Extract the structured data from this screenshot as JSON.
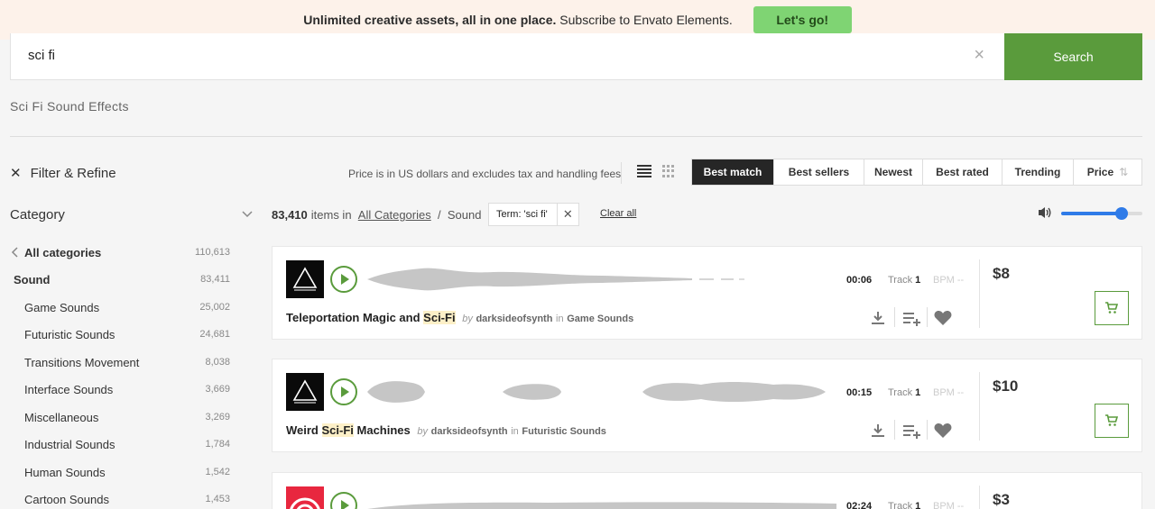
{
  "banner": {
    "text_bold": "Unlimited creative assets, all in one place.",
    "text_rest": "Subscribe to Envato Elements.",
    "button": "Let's go!"
  },
  "search": {
    "value": "sci fi",
    "clear": "×",
    "button": "Search"
  },
  "page_subtitle": "Sci Fi Sound Effects",
  "filter_label": "Filter & Refine",
  "price_note": "Price is in US dollars and excludes tax and handling fees",
  "sort_options": [
    "Best match",
    "Best sellers",
    "Newest",
    "Best rated",
    "Trending",
    "Price"
  ],
  "sort_active": "Best match",
  "category": {
    "title": "Category",
    "items": [
      {
        "label": "All categories",
        "count": "110,613"
      },
      {
        "label": "Sound",
        "count": "83,411"
      },
      {
        "label": "Game Sounds",
        "count": "25,002"
      },
      {
        "label": "Futuristic Sounds",
        "count": "24,681"
      },
      {
        "label": "Transitions Movement",
        "count": "8,038"
      },
      {
        "label": "Interface Sounds",
        "count": "3,669"
      },
      {
        "label": "Miscellaneous",
        "count": "3,269"
      },
      {
        "label": "Industrial Sounds",
        "count": "1,784"
      },
      {
        "label": "Human Sounds",
        "count": "1,542"
      },
      {
        "label": "Cartoon Sounds",
        "count": "1,453"
      }
    ]
  },
  "results": {
    "count": "83,410",
    "items_in": "items in",
    "breadcrumb_all": "All Categories",
    "breadcrumb_sep": "/",
    "breadcrumb_current": "Sound",
    "term_chip": "Term: 'sci fi'",
    "clear_all": "Clear all"
  },
  "volume": {
    "level": 0.74
  },
  "items": [
    {
      "title_pre": "Teleportation Magic and ",
      "title_hl": "Sci-Fi",
      "title_post": "",
      "by": "by",
      "author": "darksideofsynth",
      "in": "in",
      "category": "Game Sounds",
      "duration": "00:06",
      "track_label": "Track",
      "track_no": "1",
      "bpm": "BPM --",
      "price": "$8"
    },
    {
      "title_pre": "Weird ",
      "title_hl": "Sci-Fi",
      "title_post": " Machines",
      "by": "by",
      "author": "darksideofsynth",
      "in": "in",
      "category": "Futuristic Sounds",
      "duration": "00:15",
      "track_label": "Track",
      "track_no": "1",
      "bpm": "BPM --",
      "price": "$10"
    },
    {
      "duration": "02:24",
      "track_label": "Track",
      "track_no": "1",
      "bpm": "BPM --",
      "price": "$3"
    }
  ],
  "colors": {
    "accent": "#5a9b3c",
    "banner_button": "#7fd473",
    "slider": "#2f7be8"
  }
}
